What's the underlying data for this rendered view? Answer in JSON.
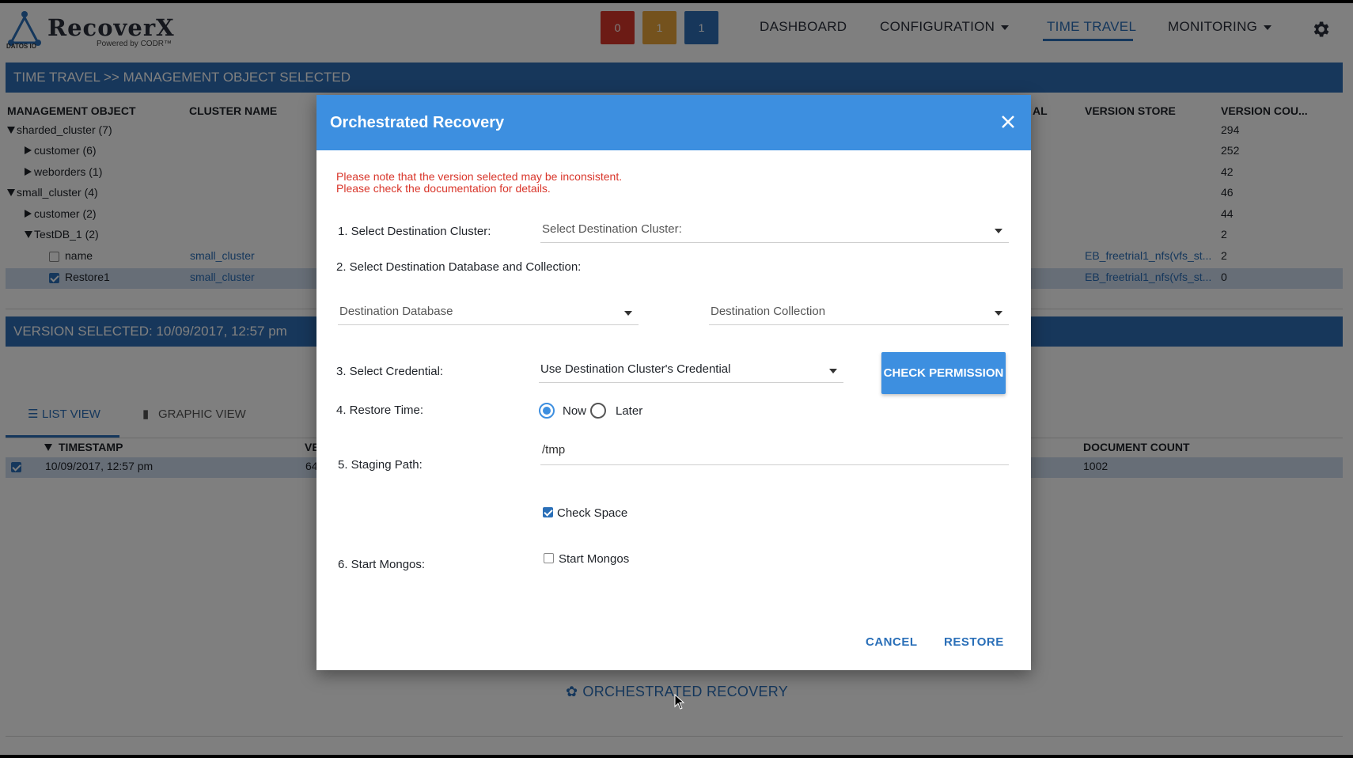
{
  "header": {
    "logo_text": "RecoverX",
    "logo_sub": "Powered by CODR™",
    "logo_small": "DATOS IO",
    "badges": [
      {
        "count": "0",
        "color": "#d9362b"
      },
      {
        "count": "1",
        "color": "#e9a43a"
      },
      {
        "count": "1",
        "color": "#2f6fb7"
      }
    ],
    "nav": {
      "dashboard": "DASHBOARD",
      "configuration": "CONFIGURATION",
      "time_travel": "TIME TRAVEL",
      "monitoring": "MONITORING"
    },
    "settings_icon": "gear-icon"
  },
  "breadcrumb": "TIME TRAVEL >> MANAGEMENT OBJECT SELECTED",
  "objects_table": {
    "columns": [
      "MANAGEMENT OBJECT",
      "CLUSTER NAME",
      "AL",
      "VERSION STORE",
      "VERSION COU..."
    ],
    "rows": [
      {
        "name": "sharded_cluster (7)",
        "cluster": "",
        "store": "",
        "count": "294"
      },
      {
        "name": "customer (6)",
        "cluster": "",
        "store": "",
        "count": "252"
      },
      {
        "name": "weborders (1)",
        "cluster": "",
        "store": "",
        "count": "42"
      },
      {
        "name": "small_cluster (4)",
        "cluster": "",
        "store": "",
        "count": "46"
      },
      {
        "name": "customer (2)",
        "cluster": "",
        "store": "",
        "count": "44"
      },
      {
        "name": "TestDB_1 (2)",
        "cluster": "",
        "store": "",
        "count": "2"
      },
      {
        "name": "name",
        "cluster": "small_cluster",
        "store": "EB_freetrial1_nfs(vfs_st...",
        "count": "2"
      },
      {
        "name": "Restore1",
        "cluster": "small_cluster",
        "store": "EB_freetrial1_nfs(vfs_st...",
        "count": "0"
      }
    ]
  },
  "version_bar": "VERSION SELECTED: 10/09/2017, 12:57 pm",
  "tabs": {
    "list": "LIST VIEW",
    "graphic": "GRAPHIC VIEW"
  },
  "versions_table": {
    "columns": [
      "TIMESTAMP",
      "VE",
      "DOCUMENT COUNT"
    ],
    "rows": [
      {
        "timestamp": "10/09/2017, 12:57 pm",
        "ve": "64",
        "doc_count": "1002"
      }
    ]
  },
  "orchestrated_link": "ORCHESTRATED RECOVERY",
  "modal": {
    "title": "Orchestrated Recovery",
    "warning_line1": "Please note that the version selected may be inconsistent.",
    "warning_line2": "Please check the documentation for details.",
    "step1_label": "1. Select Destination Cluster:",
    "step1_placeholder": "Select Destination Cluster:",
    "step2_label": "2. Select Destination Database and Collection:",
    "db_placeholder": "Destination Database",
    "collection_placeholder": "Destination Collection",
    "step3_label": "3. Select Credential:",
    "credential_value": "Use Destination Cluster's Credential",
    "check_permission": "CHECK PERMISSION",
    "step4_label": "4. Restore Time:",
    "restore_now": "Now",
    "restore_later": "Later",
    "restore_selected": "Now",
    "step5_label": "5. Staging Path:",
    "staging_path": "/tmp",
    "check_space_label": "Check Space",
    "check_space_checked": true,
    "step6_label": "6. Start Mongos:",
    "start_mongos_label": "Start Mongos",
    "start_mongos_checked": false,
    "cancel": "CANCEL",
    "restore": "RESTORE"
  }
}
